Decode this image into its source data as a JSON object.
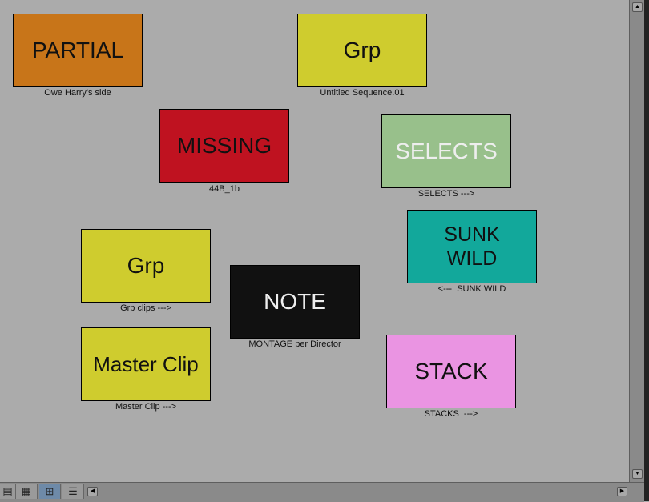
{
  "cards": [
    {
      "label": "PARTIAL",
      "caption": "Owe Harry's side",
      "color": "#c87519",
      "text_color": "#111111"
    },
    {
      "label": "Grp",
      "caption": "Untitled Sequence.01",
      "color": "#cfcc2e",
      "text_color": "#111111"
    },
    {
      "label": "MISSING",
      "caption": "44B_1b",
      "color": "#bf1220",
      "text_color": "#111111"
    },
    {
      "label": "SELECTS",
      "caption": "SELECTS --->",
      "color": "#98c08b",
      "text_color": "#eeeeee"
    },
    {
      "label": "SUNK\nWILD",
      "caption": "<---  SUNK WILD",
      "color": "#12a89b",
      "text_color": "#111111"
    },
    {
      "label": "Grp",
      "caption": "Grp clips --->",
      "color": "#cfcc2e",
      "text_color": "#111111"
    },
    {
      "label": "NOTE",
      "caption": "MONTAGE per Director",
      "color": "#111111",
      "text_color": "#eeeeee"
    },
    {
      "label": "Master Clip",
      "caption": "Master Clip --->",
      "color": "#cfcc2e",
      "text_color": "#111111"
    },
    {
      "label": "STACK",
      "caption": "STACKS  --->",
      "color": "#ea94e2",
      "text_color": "#111111"
    }
  ],
  "toolbar": {
    "views": [
      "frame-view-icon",
      "text-view-icon",
      "script-view-icon",
      "list-view-icon"
    ],
    "active_view": "script-view-icon"
  }
}
